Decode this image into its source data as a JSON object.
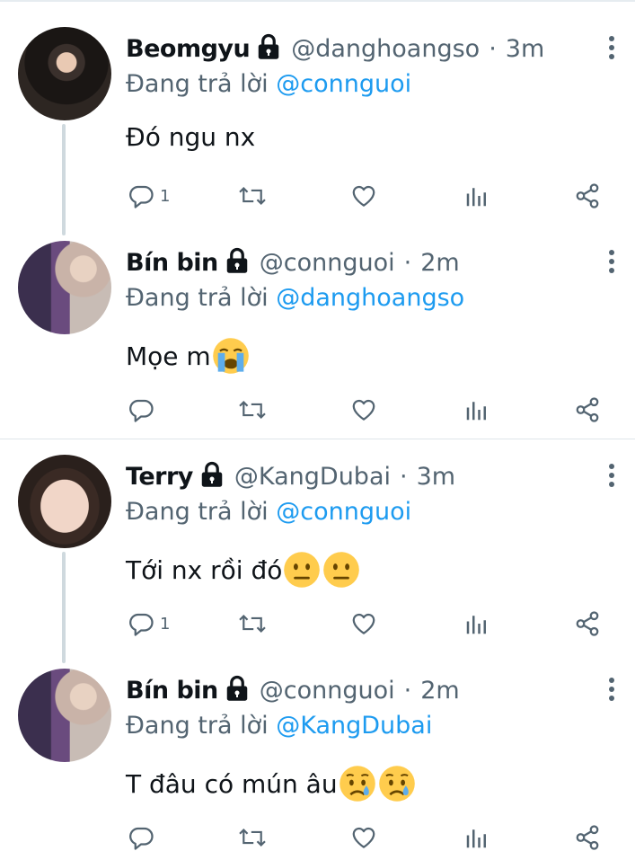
{
  "tweets": [
    {
      "name": "Beomgyu",
      "handle": "@danghoangso",
      "time": "3m",
      "reply_prefix": "Đang trả lời",
      "reply_to": "@connguoi",
      "text": "Đó ngu nx",
      "reply_count": "1",
      "emojis": []
    },
    {
      "name": "Bín bin",
      "handle": "@connguoi",
      "time": "2m",
      "reply_prefix": "Đang trả lời",
      "reply_to": "@danghoangso",
      "text": "Mọe m",
      "reply_count": "",
      "emojis": [
        "loudly-crying-face"
      ]
    },
    {
      "name": "Terry",
      "handle": "@KangDubai",
      "time": "3m",
      "reply_prefix": "Đang trả lời",
      "reply_to": "@connguoi",
      "text": "Tới nx rồi đó",
      "reply_count": "1",
      "emojis": [
        "neutral-face",
        "neutral-face"
      ]
    },
    {
      "name": "Bín bin",
      "handle": "@connguoi",
      "time": "2m",
      "reply_prefix": "Đang trả lời",
      "reply_to": "@KangDubai",
      "text": "T đâu có mún âu",
      "reply_count": "",
      "emojis": [
        "sad-but-relieved-face",
        "sad-but-relieved-face"
      ]
    }
  ],
  "separator": "·",
  "colors": {
    "accent": "#1d9bf0",
    "secondary": "#536471",
    "thread_line": "#cfd9de"
  }
}
